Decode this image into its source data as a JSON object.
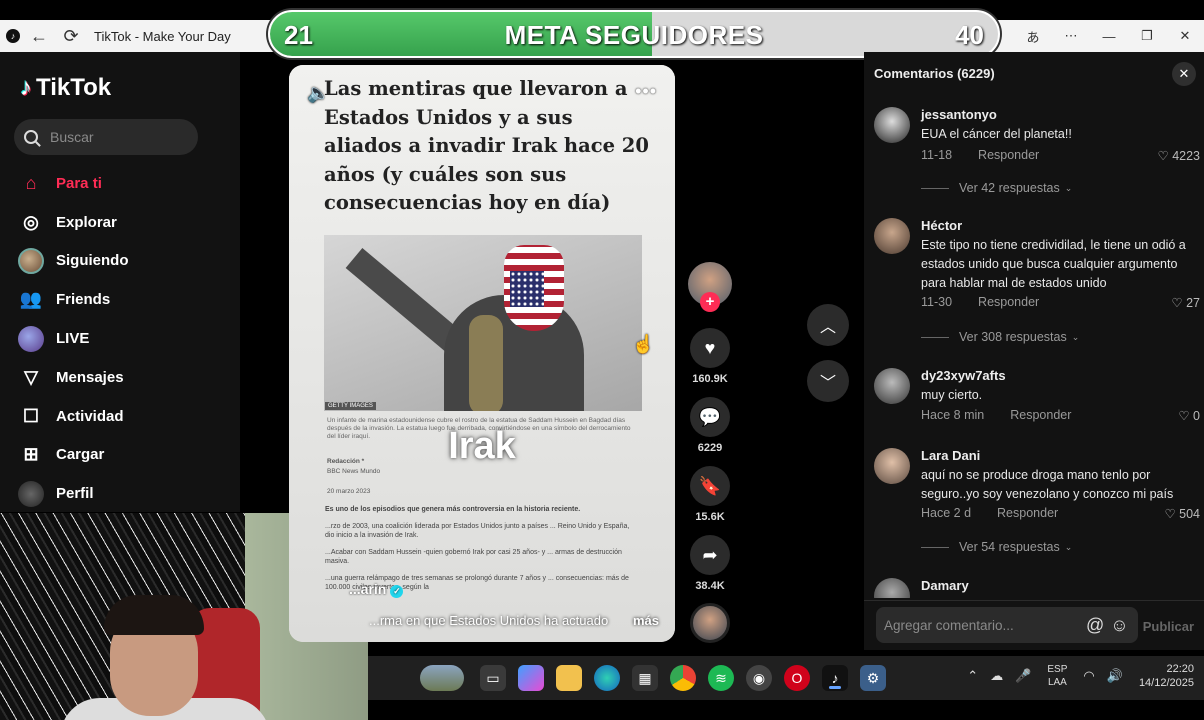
{
  "window": {
    "title": "TikTok - Make Your Day",
    "controls": [
      "translate-icon",
      "minimize-icon",
      "restore-icon",
      "close-icon"
    ]
  },
  "goal_overlay": {
    "current": "21",
    "title": "META SEGUIDORES",
    "target": "40",
    "progress": 0.525,
    "fill_color": "#3fb457"
  },
  "sidebar": {
    "brand": "TikTok",
    "search_placeholder": "Buscar",
    "items": [
      {
        "label": "Para ti",
        "icon": "home-icon",
        "active": true
      },
      {
        "label": "Explorar",
        "icon": "compass-icon"
      },
      {
        "label": "Siguiendo",
        "icon": "following-avatar-icon"
      },
      {
        "label": "Friends",
        "icon": "friends-icon"
      },
      {
        "label": "LIVE",
        "icon": "live-avatar-icon"
      },
      {
        "label": "Mensajes",
        "icon": "send-icon"
      },
      {
        "label": "Actividad",
        "icon": "activity-icon"
      },
      {
        "label": "Cargar",
        "icon": "upload-plus-icon"
      },
      {
        "label": "Perfil",
        "icon": "profile-avatar-icon"
      }
    ],
    "accent_color": "#fe2c55"
  },
  "video": {
    "headline": "Las mentiras que llevaron a Estados Unidos y a sus aliados a invadir Irak hace 20 años (y cuáles son sus consecuencias hoy en día)",
    "photo_credit": "GETTY IMAGES",
    "photo_caption": "Un infante de marina estadounidense cubre el rostro de la estatua de Saddam Hussein en Bagdad días después de la invasión. La estatua luego fue derribada, convirtiéndose en una símbolo del derrocamiento del líder iraquí.",
    "byline_1": "Redacción *",
    "byline_2": "BBC News Mundo",
    "date": "20 marzo 2023",
    "overlay_word": "Irak",
    "body_1": "Es uno de los episodios que genera más controversia en la historia reciente.",
    "body_2": "...rzo de 2003, una coalición liderada por Estados Unidos junto a países ... Reino Unido y España, dio inicio a la invasión de Irak.",
    "body_3": "...Acabar con Saddam Hussein -quien gobernó Irak por casi 25 años- y ... armas de destrucción masiva.",
    "body_4": "...una guerra relámpago de tres semanas se prolongó durante 7 años y ... consecuencias: más de 100.000 civiles muertos, según la",
    "author": "...arin",
    "description": "...rma en que Estados Unidos ha actuado",
    "more_label": "más"
  },
  "actions": {
    "likes": "160.9K",
    "comments": "6229",
    "saves": "15.6K",
    "shares": "38.4K"
  },
  "comments_panel": {
    "title": "Comentarios (6229)",
    "reply_label": "Responder",
    "input_placeholder": "Agregar comentario...",
    "publish_label": "Publicar",
    "items": [
      {
        "user": "jessantonyo",
        "text": "EUA el cáncer del planeta!!",
        "date": "11-18",
        "likes": "4223",
        "replies": "Ver 42 respuestas"
      },
      {
        "user": "Héctor",
        "text": "Este tipo no tiene credividilad, le tiene un odió a estados unido que busca cualquier argumento para hablar mal de estados unido",
        "date": "11-30",
        "likes": "27",
        "replies": "Ver 308 respuestas"
      },
      {
        "user": "dy23xyw7afts",
        "text": "muy cierto.",
        "date": "Hace 8 min",
        "likes": "0",
        "replies": ""
      },
      {
        "user": "Lara Dani",
        "text": "aquí no se produce droga mano tenlo por seguro..yo soy venezolano y conozco mi país",
        "date": "Hace 2 d",
        "likes": "504",
        "replies": "Ver 54 respuestas"
      },
      {
        "user": "Damary",
        "text": "",
        "date": "",
        "likes": "",
        "replies": ""
      }
    ]
  },
  "taskbar": {
    "lang_1": "ESP",
    "lang_2": "LAA",
    "time": "22:20",
    "date": "14/12/2025"
  }
}
